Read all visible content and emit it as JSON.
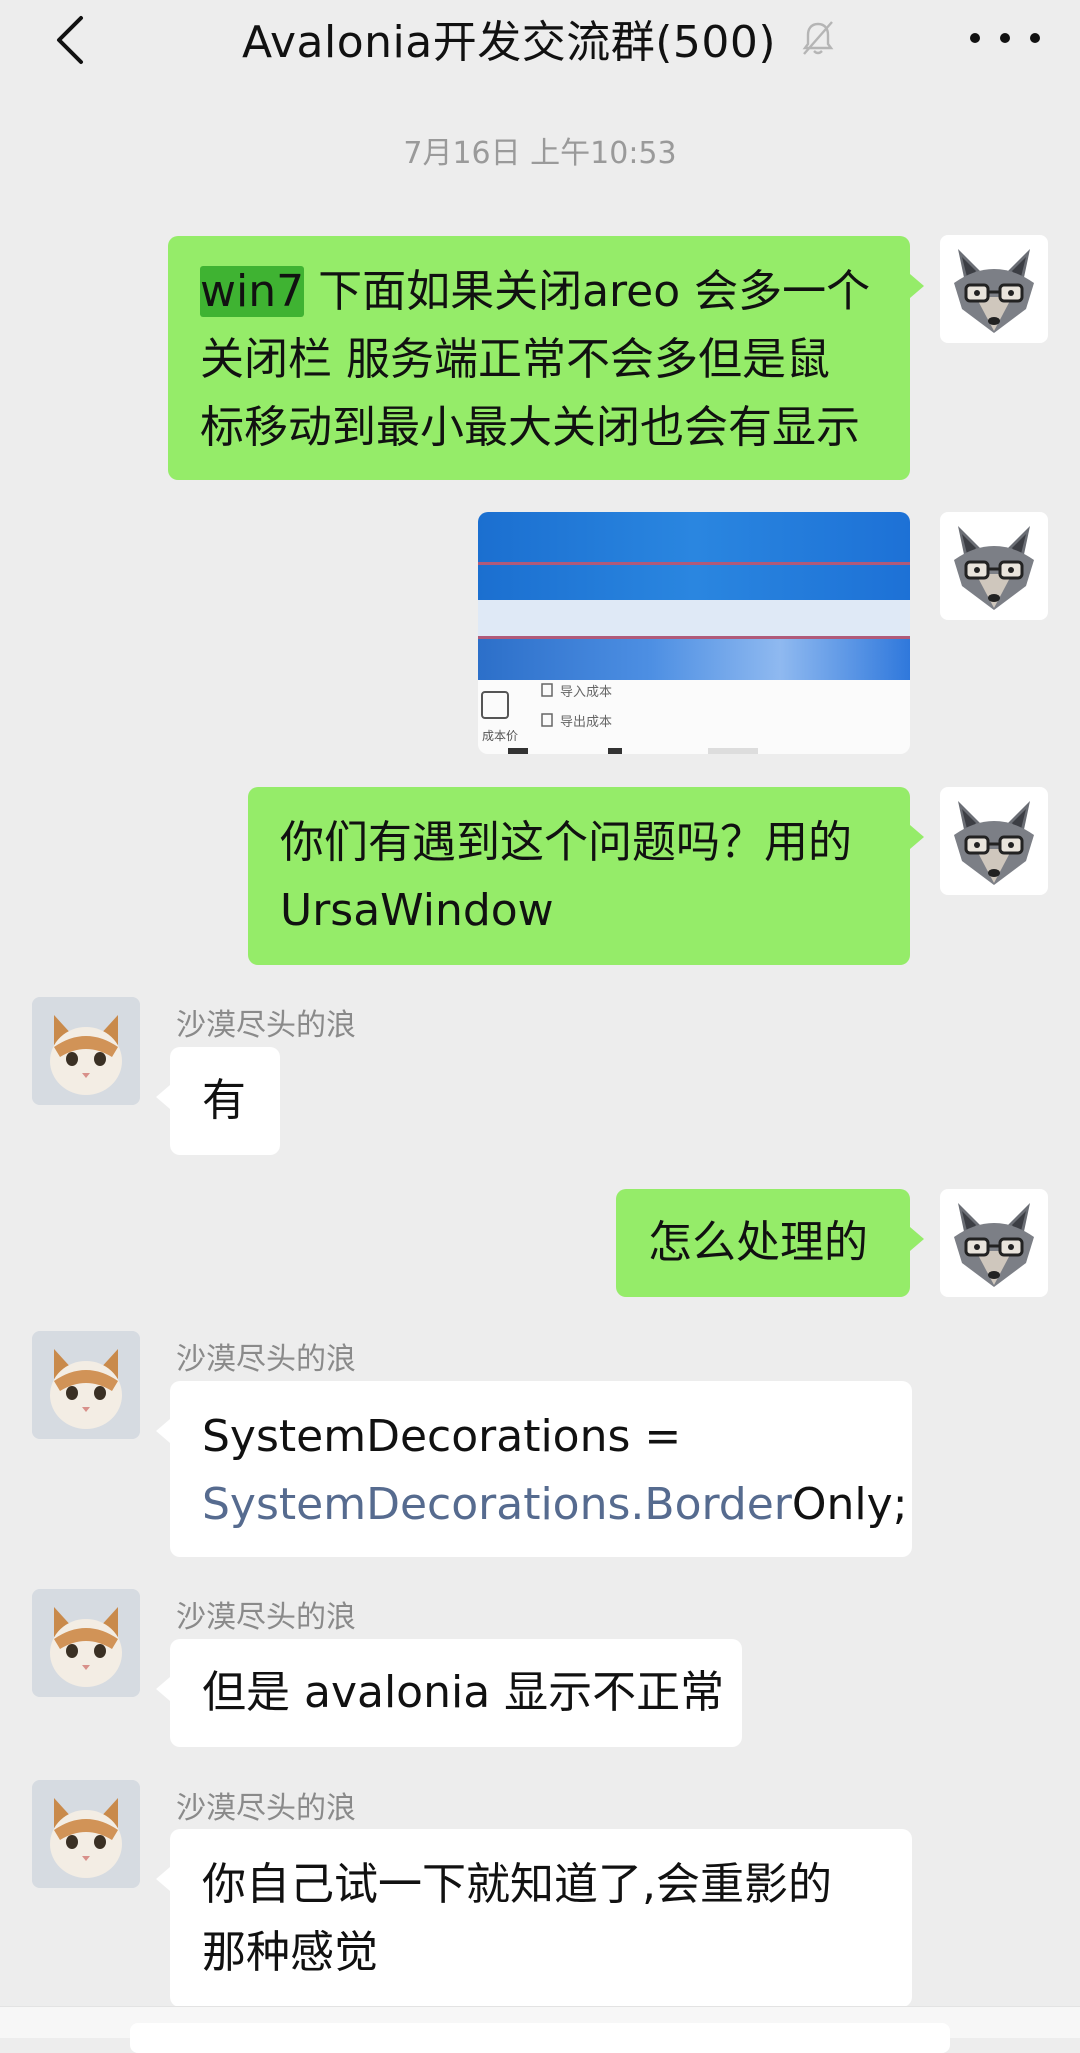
{
  "header": {
    "title": "Avalonia开发交流群(500)",
    "back_icon": "chevron-left-icon",
    "mute_icon": "bell-muted-icon",
    "more_icon": "more-dots-icon"
  },
  "timestamp": "7月16日 上午10:53",
  "messages": [
    {
      "from": "me",
      "parts": [
        "win7",
        " 下面如果关闭areo 会多一个",
        "关闭栏 服务端正常不会多但是鼠",
        "标移动到最小最大关闭也会有显示"
      ]
    },
    {
      "from": "me",
      "type": "image",
      "image_text": [
        "导入成本",
        "导出成本",
        "成本价"
      ]
    },
    {
      "from": "me",
      "lines": [
        "你们有遇到这个问题吗？用的",
        "UrsaWindow"
      ]
    },
    {
      "from": "other",
      "sender": "沙漠尽头的浪",
      "lines": [
        "有"
      ]
    },
    {
      "from": "me",
      "lines": [
        "怎么处理的"
      ]
    },
    {
      "from": "other",
      "sender": "沙漠尽头的浪",
      "line1": "SystemDecorations =",
      "line2_link": "SystemDecorations.Border",
      "line2_rest": "Only;"
    },
    {
      "from": "other",
      "sender": "沙漠尽头的浪",
      "lines": [
        "但是 avalonia 显示不正常"
      ]
    },
    {
      "from": "other",
      "sender": "沙漠尽头的浪",
      "lines": [
        "你自己试一下就知道了,会重影的",
        "那种感觉"
      ]
    }
  ],
  "colors": {
    "me_bubble": "#95ec69",
    "other_bubble": "#ffffff",
    "background": "#ededed",
    "highlight": "#3fb332",
    "link": "#566b8f"
  }
}
